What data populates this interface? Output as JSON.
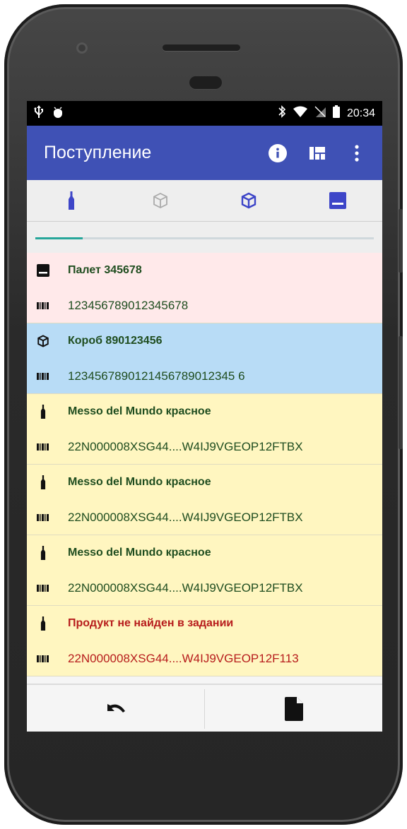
{
  "status_bar": {
    "time": "20:34",
    "left_icons": [
      "usb-icon",
      "android-debug-icon"
    ],
    "right_icons": [
      "bluetooth-icon",
      "wifi-icon",
      "no-sim-icon",
      "battery-icon"
    ]
  },
  "app_bar": {
    "title": "Поступление",
    "actions": [
      "info-icon",
      "view-quilt-icon",
      "more-vert-icon"
    ]
  },
  "tabs": [
    {
      "icon": "bottle-icon",
      "active": true
    },
    {
      "icon": "box-outline-icon",
      "active": false
    },
    {
      "icon": "box-icon",
      "active": false
    },
    {
      "icon": "pallet-icon",
      "active": false
    }
  ],
  "progress": {
    "fraction": 0.14,
    "color": "#26a69a"
  },
  "items": [
    {
      "type": "pallet",
      "name": "Палет 345678",
      "code": "123456789012345678",
      "bg": "#ffe9ea"
    },
    {
      "type": "box",
      "name": "Короб 890123456",
      "code": "1234567890121456789012345 6",
      "bg": "#b8dcf6"
    },
    {
      "type": "bottle",
      "name": "Messo del Mundo красное",
      "code": "22N000008XSG44....W4IJ9VGEOP12FTBX",
      "bg": "#fff6c0"
    },
    {
      "type": "bottle",
      "name": "Messo del Mundo красное",
      "code": "22N000008XSG44....W4IJ9VGEOP12FTBX",
      "bg": "#fff6c0"
    },
    {
      "type": "bottle",
      "name": "Messo del Mundo красное",
      "code": "22N000008XSG44....W4IJ9VGEOP12FTBX",
      "bg": "#fff6c0"
    },
    {
      "type": "bottle",
      "name": "Продукт не найден в задании",
      "code": "22N000008XSG44....W4IJ9VGEOP12F113",
      "bg": "#fff6c0",
      "error": true
    }
  ],
  "bottom_bar": [
    "undo-icon",
    "document-icon"
  ],
  "colors": {
    "primary": "#3f51b5",
    "accent": "#3d45c8",
    "error": "#b71c1c",
    "text_dark_green": "#1f4d1f"
  }
}
